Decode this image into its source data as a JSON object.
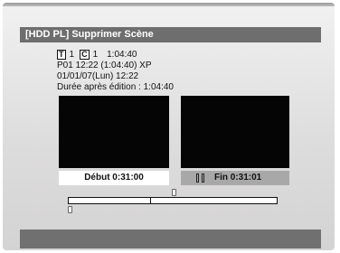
{
  "title": "[HDD PL] Supprimer Scène",
  "info": {
    "title_badge": "T",
    "title_num": "1",
    "chapter_badge": "C",
    "chapter_num": "1",
    "chapter_time": "1:04:40",
    "line2": "P01  12:22 (1:04:40) XP",
    "line3": "01/01/07(Lun)  12:22",
    "line4": "Durée après édition : 1:04:40"
  },
  "start_label": "Début  0:31:00",
  "end_label": "Fin  0:31:01"
}
